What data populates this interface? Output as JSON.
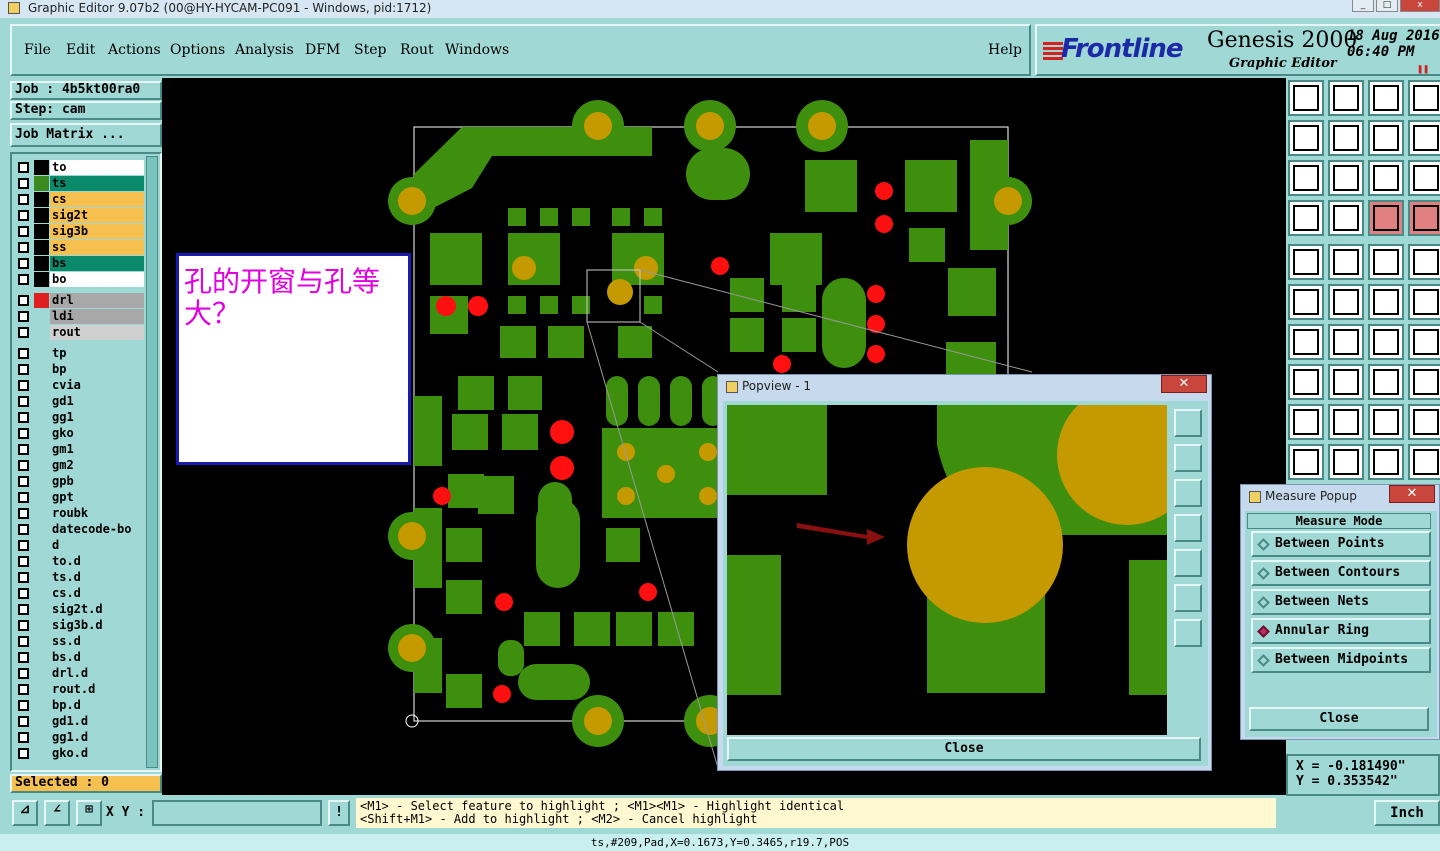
{
  "window": {
    "title": "Graphic Editor 9.07b2 (00@HY-HYCAM-PC091 - Windows, pid:1712)"
  },
  "menu": [
    "File",
    "Edit",
    "Actions",
    "Options",
    "Analysis",
    "DFM",
    "Step",
    "Rout",
    "Windows"
  ],
  "help": "Help",
  "brand": {
    "logo": "Frontline",
    "product": "Genesis 2000",
    "subtitle": "Graphic Editor",
    "date": "18 Aug 2016",
    "time": "06:40 PM"
  },
  "job": {
    "job_label": "Job : 4b5kt00ra0",
    "step_label": "Step: cam",
    "matrix_button": "Job Matrix ..."
  },
  "layers": [
    {
      "name": "to",
      "color": "#ffffff",
      "swatch": "#000000"
    },
    {
      "name": "ts",
      "color": "#0a8a6a",
      "swatch": "#3a8a20"
    },
    {
      "name": "cs",
      "color": "#f5c050",
      "swatch": "#000000"
    },
    {
      "name": "sig2t",
      "color": "#f5c050",
      "swatch": "#000000"
    },
    {
      "name": "sig3b",
      "color": "#f5c050",
      "swatch": "#000000"
    },
    {
      "name": "ss",
      "color": "#f5c050",
      "swatch": "#000000"
    },
    {
      "name": "bs",
      "color": "#0a8a6a",
      "swatch": "#000000"
    },
    {
      "name": "bo",
      "color": "#ffffff",
      "swatch": "#000000"
    },
    {
      "name": "drl",
      "color": "#a8a8a8",
      "swatch": "#e02020"
    },
    {
      "name": "ldi",
      "color": "#a8a8a8",
      "swatch": "#9fd8d4"
    },
    {
      "name": "rout",
      "color": "#d0d0d0",
      "swatch": "#9fd8d4"
    },
    {
      "name": "tp",
      "color": "#9fd8d4",
      "swatch": "#9fd8d4"
    },
    {
      "name": "bp",
      "color": "#9fd8d4",
      "swatch": "#9fd8d4"
    },
    {
      "name": "cvia",
      "color": "#9fd8d4",
      "swatch": "#9fd8d4"
    },
    {
      "name": "gd1",
      "color": "#9fd8d4",
      "swatch": "#9fd8d4"
    },
    {
      "name": "gg1",
      "color": "#9fd8d4",
      "swatch": "#9fd8d4"
    },
    {
      "name": "gko",
      "color": "#9fd8d4",
      "swatch": "#9fd8d4"
    },
    {
      "name": "gm1",
      "color": "#9fd8d4",
      "swatch": "#9fd8d4"
    },
    {
      "name": "gm2",
      "color": "#9fd8d4",
      "swatch": "#9fd8d4"
    },
    {
      "name": "gpb",
      "color": "#9fd8d4",
      "swatch": "#9fd8d4"
    },
    {
      "name": "gpt",
      "color": "#9fd8d4",
      "swatch": "#9fd8d4"
    },
    {
      "name": "roubk",
      "color": "#9fd8d4",
      "swatch": "#9fd8d4"
    },
    {
      "name": "datecode-bo",
      "color": "#9fd8d4",
      "swatch": "#9fd8d4"
    },
    {
      "name": "d",
      "color": "#9fd8d4",
      "swatch": "#9fd8d4"
    },
    {
      "name": "to.d",
      "color": "#9fd8d4",
      "swatch": "#9fd8d4"
    },
    {
      "name": "ts.d",
      "color": "#9fd8d4",
      "swatch": "#9fd8d4"
    },
    {
      "name": "cs.d",
      "color": "#9fd8d4",
      "swatch": "#9fd8d4"
    },
    {
      "name": "sig2t.d",
      "color": "#9fd8d4",
      "swatch": "#9fd8d4"
    },
    {
      "name": "sig3b.d",
      "color": "#9fd8d4",
      "swatch": "#9fd8d4"
    },
    {
      "name": "ss.d",
      "color": "#9fd8d4",
      "swatch": "#9fd8d4"
    },
    {
      "name": "bs.d",
      "color": "#9fd8d4",
      "swatch": "#9fd8d4"
    },
    {
      "name": "drl.d",
      "color": "#9fd8d4",
      "swatch": "#9fd8d4"
    },
    {
      "name": "rout.d",
      "color": "#9fd8d4",
      "swatch": "#9fd8d4"
    },
    {
      "name": "bp.d",
      "color": "#9fd8d4",
      "swatch": "#9fd8d4"
    },
    {
      "name": "gd1.d",
      "color": "#9fd8d4",
      "swatch": "#9fd8d4"
    },
    {
      "name": "gg1.d",
      "color": "#9fd8d4",
      "swatch": "#9fd8d4"
    },
    {
      "name": "gko.d",
      "color": "#9fd8d4",
      "swatch": "#9fd8d4"
    }
  ],
  "selected": "Selected : 0",
  "annotation": "孔的开窗与孔等大？",
  "popview": {
    "title": "Popview - 1",
    "close": "Close"
  },
  "measure": {
    "title": "Measure Popup",
    "mode_label": "Measure Mode",
    "options": [
      "Between Points",
      "Between Contours",
      "Between Nets",
      "Annular Ring",
      "Between Midpoints"
    ],
    "selected": "Annular Ring",
    "close": "Close"
  },
  "coords": {
    "x": "X = -0.181490\"",
    "y": "Y = 0.353542\""
  },
  "bottom": {
    "xy_label": "X Y :",
    "xy_value": "",
    "hint1": "<M1> - Select feature to highlight ; <M1><M1> - Highlight identical",
    "hint2": "<Shift+M1> - Add to highlight ; <M2> - Cancel highlight",
    "units": "Inch"
  },
  "status": "ts,#209,Pad,X=0.1673,Y=0.3465,r19.7,POS",
  "colors": {
    "pad_green": "#3f8f0f",
    "pad_gold": "#c49a00",
    "drill_red": "#ff1010",
    "panel": "#9fd8d4"
  }
}
